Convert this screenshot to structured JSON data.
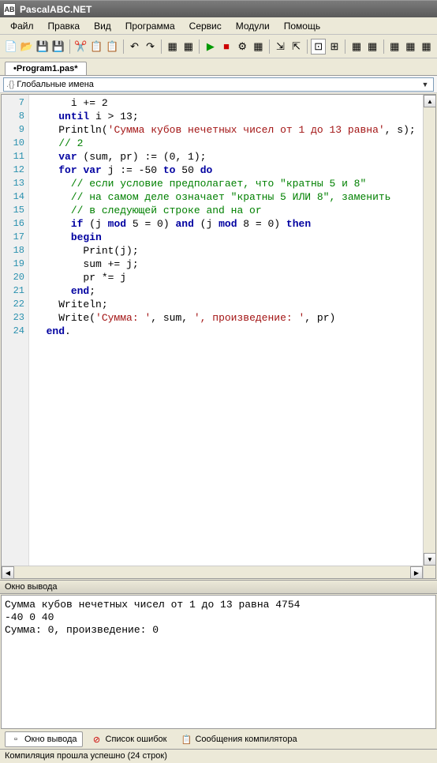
{
  "title": "PascalABC.NET",
  "menu": [
    "Файл",
    "Правка",
    "Вид",
    "Программа",
    "Сервис",
    "Модули",
    "Помощь"
  ],
  "tab_name": "•Program1.pas*",
  "namespace": {
    "icon": ".{}",
    "label": "Глобальные имена"
  },
  "gutter_lines": [
    "7",
    "8",
    "9",
    "10",
    "11",
    "12",
    "13",
    "14",
    "15",
    "16",
    "17",
    "18",
    "19",
    "20",
    "21",
    "22",
    "23",
    "24"
  ],
  "code": {
    "l7": {
      "indent": "      ",
      "t1": "i += 2"
    },
    "l8": {
      "indent": "    ",
      "k1": "until",
      "t1": " i > 13;"
    },
    "l9": {
      "indent": "    ",
      "t1": "Println(",
      "s1": "'Сумма кубов нечетных чисел от 1 до 13 равна'",
      "t2": ", s);"
    },
    "l10": {
      "indent": "    ",
      "c": "// 2"
    },
    "l11": {
      "indent": "    ",
      "k1": "var",
      "t1": " (sum, pr) := (0, 1);"
    },
    "l12": {
      "indent": "    ",
      "k1": "for",
      "t1": " ",
      "k2": "var",
      "t2": " j := -50 ",
      "k3": "to",
      "t3": " 50 ",
      "k4": "do"
    },
    "l13": {
      "indent": "      ",
      "c": "// если условие предполагает, что \"кратны 5 и 8\""
    },
    "l14": {
      "indent": "      ",
      "c": "// на самом деле означает \"кратны 5 ИЛИ 8\", заменить"
    },
    "l15": {
      "indent": "      ",
      "c": "// в следующей строке and на or"
    },
    "l16": {
      "indent": "      ",
      "k1": "if",
      "t1": " (j ",
      "k2": "mod",
      "t2": " 5 = 0) ",
      "k3": "and",
      "t3": " (j ",
      "k4": "mod",
      "t4": " 8 = 0) ",
      "k5": "then"
    },
    "l17": {
      "indent": "      ",
      "k1": "begin"
    },
    "l18": {
      "indent": "        ",
      "t1": "Print(j);"
    },
    "l19": {
      "indent": "        ",
      "t1": "sum += j;"
    },
    "l20": {
      "indent": "        ",
      "t1": "pr *= j"
    },
    "l21": {
      "indent": "      ",
      "k1": "end",
      "t1": ";"
    },
    "l22": {
      "indent": "    ",
      "t1": "Writeln;"
    },
    "l23": {
      "indent": "    ",
      "t1": "Write(",
      "s1": "'Сумма: '",
      "t2": ", sum, ",
      "s2": "', произведение: '",
      "t3": ", pr)"
    },
    "l24": {
      "indent": "  ",
      "k1": "end",
      "t1": "."
    }
  },
  "output": {
    "header": "Окно вывода",
    "lines": [
      "Сумма кубов нечетных чисел от 1 до 13 равна 4754",
      "-40 0 40 ",
      "Сумма: 0, произведение: 0"
    ]
  },
  "bottom_tabs": {
    "t1": "Окно вывода",
    "t2": "Список ошибок",
    "t3": "Сообщения компилятора"
  },
  "status": "Компиляция прошла успешно (24 строк)"
}
